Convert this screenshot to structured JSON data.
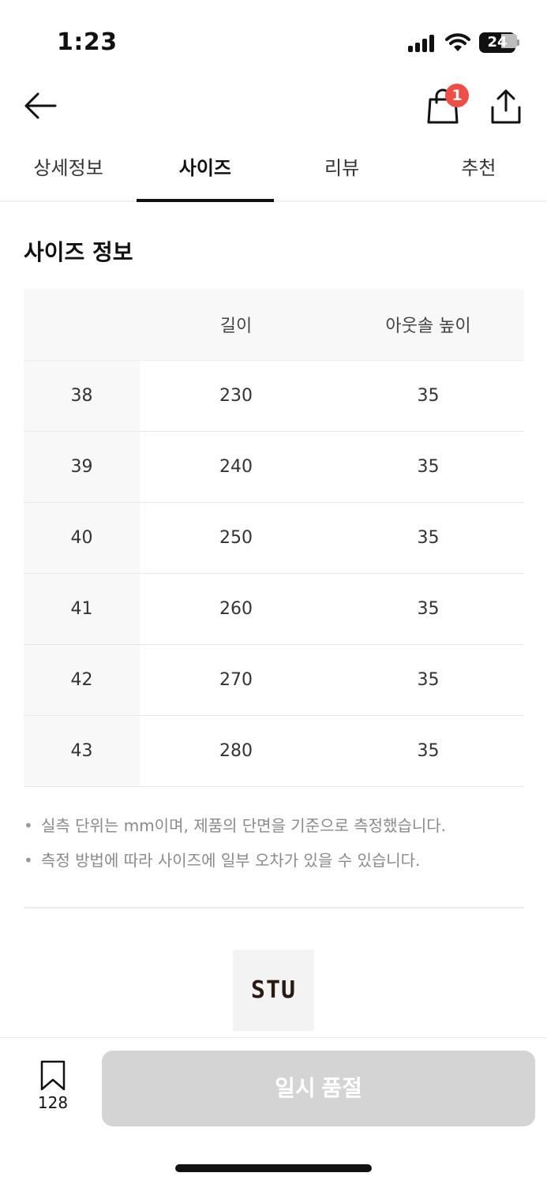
{
  "status_bar": {
    "time": "1:23",
    "battery": "24"
  },
  "nav": {
    "cart_badge": "1"
  },
  "tabs": [
    {
      "label": "상세정보",
      "active": false
    },
    {
      "label": "사이즈",
      "active": true
    },
    {
      "label": "리뷰",
      "active": false
    },
    {
      "label": "추천",
      "active": false
    }
  ],
  "size_info": {
    "title": "사이즈 정보",
    "headers": [
      "",
      "길이",
      "아웃솔 높이"
    ],
    "rows": [
      [
        "38",
        "230",
        "35"
      ],
      [
        "39",
        "240",
        "35"
      ],
      [
        "40",
        "250",
        "35"
      ],
      [
        "41",
        "260",
        "35"
      ],
      [
        "42",
        "270",
        "35"
      ],
      [
        "43",
        "280",
        "35"
      ]
    ],
    "notes": [
      "실측 단위는 mm이며, 제품의 단면을 기준으로 측정했습니다.",
      "측정 방법에 따라 사이즈에 일부 오차가 있을 수 있습니다."
    ],
    "bullet": "•"
  },
  "brand": {
    "logo_text": "STU"
  },
  "bottom_bar": {
    "bookmark_count": "128",
    "soldout_label": "일시 품절"
  },
  "colors": {
    "badge": "#f04e45",
    "soldout_button": "#d4d4d4",
    "table_header_bg": "#f8f8f8"
  },
  "icons": [
    "back-arrow-icon",
    "shopping-bag-icon",
    "share-icon",
    "bookmark-icon",
    "signal-icon",
    "wifi-icon",
    "battery-icon"
  ]
}
